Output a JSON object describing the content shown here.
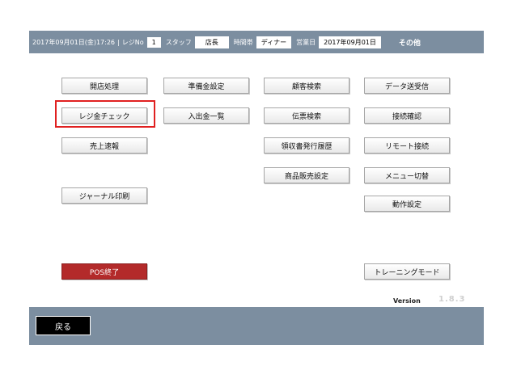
{
  "header": {
    "datetime": "2017年09月01日(金)17:26",
    "register_label": "レジNo",
    "register_no": "1",
    "staff_label": "スタッフ",
    "staff_value": "店長",
    "timezone_label": "時間帯",
    "timezone_value": "ディナー",
    "business_day_label": "営業日",
    "business_day_value": "2017年09月01日",
    "other_label": "その他"
  },
  "buttons": {
    "store_open": "開店処理",
    "prep_money": "準備金設定",
    "customer_search": "顧客検索",
    "data_send_receive": "データ送受信",
    "register_check": "レジ金チェック",
    "cash_inout_list": "入出金一覧",
    "slip_search": "伝票検索",
    "connection_check": "接続確認",
    "sales_report": "売上速報",
    "receipt_history": "領収書発行履歴",
    "remote_connect": "リモート接続",
    "product_sales_settings": "商品販売設定",
    "menu_switch": "メニュー切替",
    "journal_print": "ジャーナル印刷",
    "operation_settings": "動作設定",
    "pos_end": "POS終了",
    "training_mode": "トレーニングモード"
  },
  "footer": {
    "version_label": "Version",
    "version_value": "1.8.3",
    "back_label": "戻る"
  }
}
